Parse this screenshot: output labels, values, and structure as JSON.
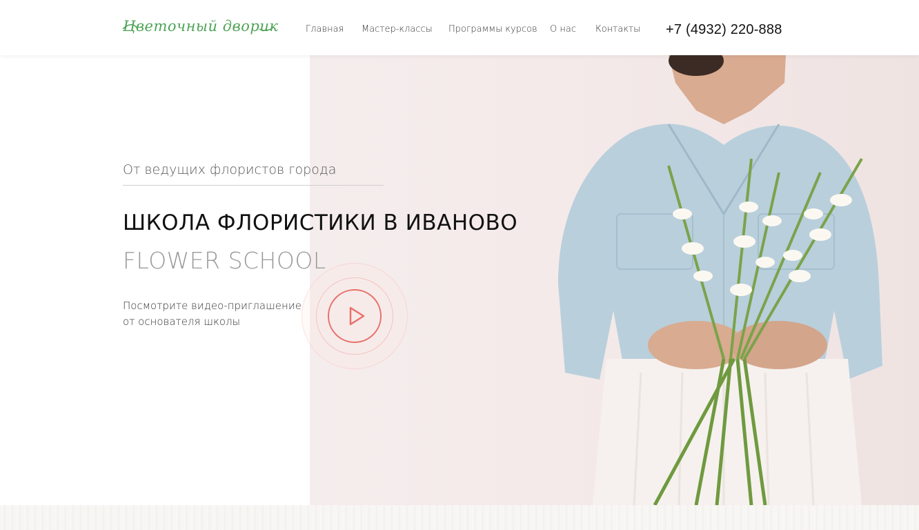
{
  "header": {
    "logo_text": "Цветочный дворик",
    "nav": [
      {
        "label": "Главная"
      },
      {
        "label": "Мастер-классы"
      },
      {
        "label": "Программы курсов"
      },
      {
        "label": "О нас"
      },
      {
        "label": "Контакты"
      }
    ],
    "phone": "+7 (4932) 220-888"
  },
  "hero": {
    "subtitle": "От ведущих флористов города",
    "title": "ШКОЛА ФЛОРИСТИКИ В ИВАНОВО",
    "title_en": "FLOWER SCHOOL",
    "video_text_line1": "Посмотрите видео-приглашение",
    "video_text_line2": "от основателя школы"
  },
  "colors": {
    "logo_green": "#4ea356",
    "play_accent": "#e8716a",
    "photo_bg": "#f4eae9"
  },
  "icons": {
    "play": "play-icon"
  }
}
